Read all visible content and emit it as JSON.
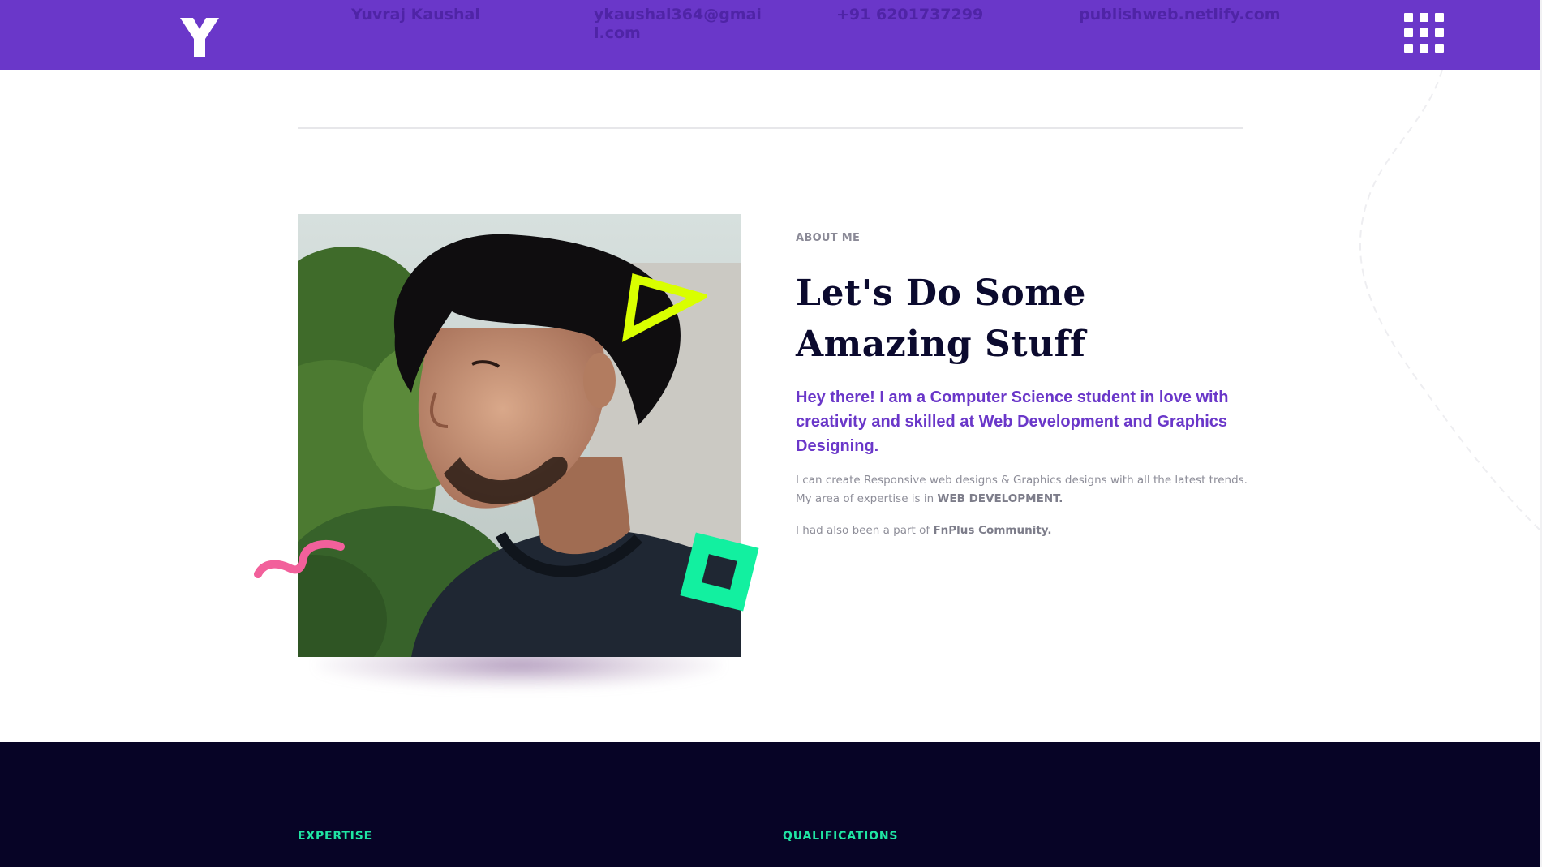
{
  "header": {
    "logo_letter": "Y",
    "name": "Yuvraj Kaushal",
    "email": "ykaushal364@gmail.com",
    "phone": "+91 6201737299",
    "site": "publishweb.netlify.com",
    "menu_icon": "grid-menu-icon"
  },
  "about": {
    "label": "ABOUT ME",
    "heading": "Let's Do Some Amazing Stuff",
    "lead": "Hey there! I am a Computer Science student in love with creativity and skilled at Web Development and Graphics Designing.",
    "body1_prefix": "I can create Responsive web designs & Graphics designs with all the latest trends. My area of expertise is in ",
    "body1_bold": "WEB DEVELOPMENT.",
    "body2_prefix": "I had also been a part of ",
    "body2_bold": "FnPlus Community."
  },
  "sections": {
    "expertise_label": "EXPERTISE",
    "qualifications_label": "QUALIFICATIONS"
  },
  "colors": {
    "header_bg": "#6a37c9",
    "header_text": "#4f24a6",
    "heading": "#0b0a2e",
    "lead": "#6a37c9",
    "dark_bg": "#070426",
    "accent_green": "#1fe5a3",
    "shape_yellow": "#d9ff00",
    "shape_green": "#12f0a0",
    "shape_pink": "#f2609b"
  }
}
